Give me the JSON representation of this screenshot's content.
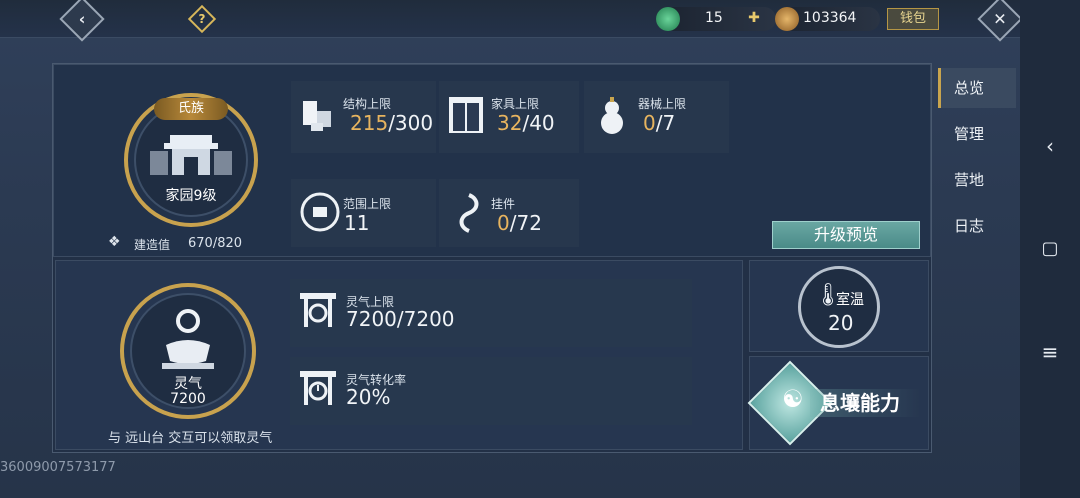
{
  "topbar": {
    "back_icon": "back-chevron-icon",
    "help_icon": "question-icon",
    "jade_value": "15",
    "coin_value": "103364",
    "wallet_label": "钱包",
    "close_icon": "close-icon"
  },
  "clan": {
    "badge": "氏族",
    "level": "家园9级",
    "build_label": "建造值",
    "build_value": "670/820"
  },
  "limits": {
    "structure": {
      "label": "结构上限",
      "current": "215",
      "max": "/300"
    },
    "furniture": {
      "label": "家具上限",
      "current": "32",
      "max": "/40"
    },
    "device": {
      "label": "器械上限",
      "current": "0",
      "max": "/7"
    },
    "range": {
      "label": "范围上限",
      "value": "11"
    },
    "pendant": {
      "label": "挂件",
      "current": "0",
      "max": "/72"
    }
  },
  "upgrade_button": "升级预览",
  "spirit": {
    "name": "灵气",
    "value": "7200",
    "hint": "与 远山台 交互可以领取灵气",
    "cap_label": "灵气上限",
    "cap_value": "7200/7200",
    "rate_label": "灵气转化率",
    "rate_value": "20%"
  },
  "temperature": {
    "label": "室温",
    "value": "20"
  },
  "ability": {
    "label": "息壤能力"
  },
  "tabs": [
    "总览",
    "管理",
    "营地",
    "日志"
  ],
  "uid": "36009007573177",
  "colors": {
    "gold": "#e7b45f",
    "accent": "#c8a24e",
    "teal": "#5a9a97"
  }
}
